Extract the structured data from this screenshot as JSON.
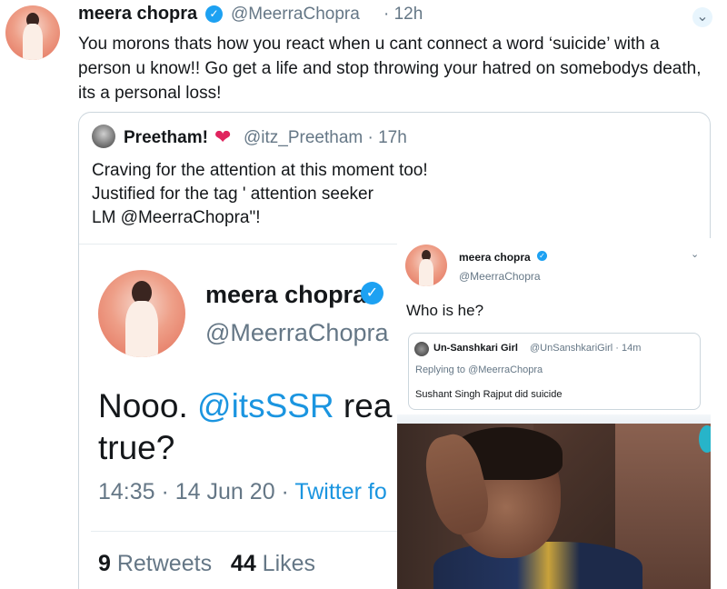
{
  "main_tweet": {
    "name": "meera chopra",
    "handle": "@MeerraChopra",
    "time": "· 12h",
    "text": "You morons thats how you react when u cant connect a word ‘suicide’ with a person u know!! Go get a life and stop throwing your hatred on somebodys death, its a personal loss!",
    "caret_icon": "chevron-down-icon"
  },
  "quoted_tweet": {
    "name": "Preetham!",
    "heart": "❤",
    "handle": "@itz_Preetham · 17h",
    "lines": [
      "Craving for the attention at this moment too!",
      "Justified for the tag ' attention seeker",
      "LM @MeerraChopra\"!"
    ]
  },
  "big_screenshot": {
    "name": "meera chopra",
    "handle": "@MeerraChopra",
    "text_prefix": "Nooo. ",
    "mention": "@itsSSR",
    "text_suffix": " rea",
    "text_line2": "true?",
    "meta_time": "14:35 · 14 Jun 20 · ",
    "meta_source": "Twitter fo",
    "retweets_count": "9",
    "retweets_label": " Retweets",
    "likes_count": "44",
    "likes_label": " Likes"
  },
  "small_screenshot": {
    "name": "meera chopra",
    "handle": "@MeerraChopra",
    "text": "Who is he?",
    "quote": {
      "name": "Un-Sanshkari Girl",
      "handle": "@UnSanshkariGirl · 14m",
      "replying": "Replying to @MeerraChopra",
      "text": "Sushant Singh Rajput did suicide"
    }
  },
  "colors": {
    "link": "#1b95e0",
    "verified": "#1da1f2",
    "muted": "#657786",
    "heart": "#e0245e"
  }
}
